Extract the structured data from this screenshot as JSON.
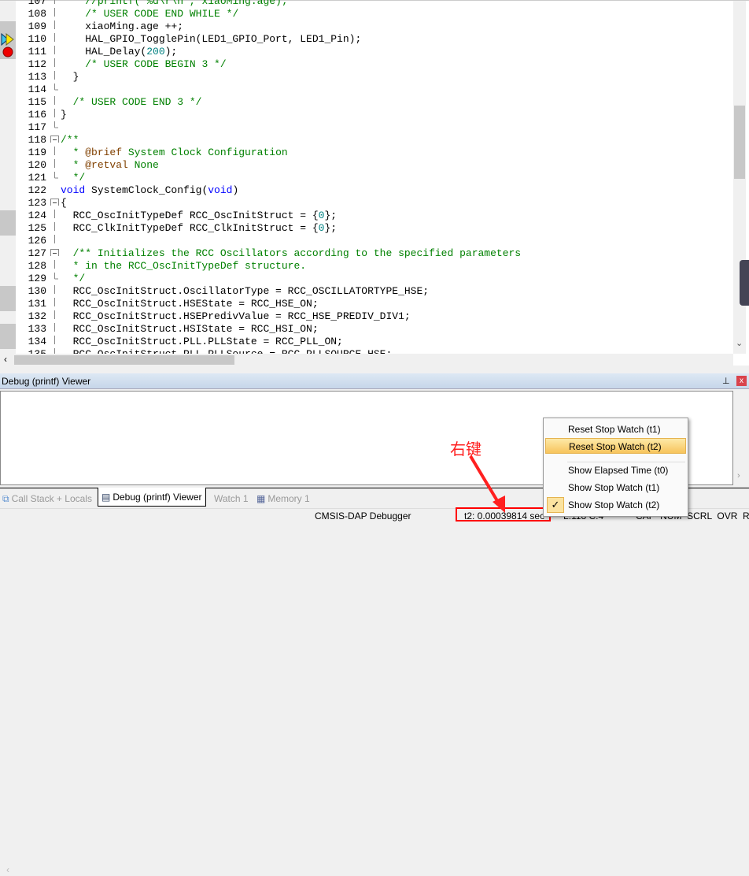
{
  "editor": {
    "lines": [
      {
        "n": "107",
        "fold": "line",
        "segs": [
          [
            "    ",
            ""
          ],
          [
            "//printf(\"%d\\r\\n\", xiaoMing.age);",
            "c"
          ]
        ]
      },
      {
        "n": "108",
        "fold": "line",
        "segs": [
          [
            "    ",
            ""
          ],
          [
            "/* USER CODE END WHILE */",
            "c"
          ]
        ]
      },
      {
        "n": "109",
        "fold": "line",
        "segs": [
          [
            "    xiaoMing.age ++;",
            ""
          ]
        ]
      },
      {
        "n": "110",
        "fold": "line",
        "segs": [
          [
            "    HAL_GPIO_TogglePin(LED1_GPIO_Port, LED1_Pin);",
            ""
          ]
        ]
      },
      {
        "n": "111",
        "fold": "line",
        "segs": [
          [
            "    HAL_Delay(",
            ""
          ],
          [
            "200",
            "n"
          ],
          [
            ");",
            ""
          ]
        ]
      },
      {
        "n": "112",
        "fold": "line",
        "segs": [
          [
            "    ",
            ""
          ],
          [
            "/* USER CODE BEGIN 3 */",
            "c"
          ]
        ]
      },
      {
        "n": "113",
        "fold": "line",
        "segs": [
          [
            "  }",
            ""
          ]
        ]
      },
      {
        "n": "114",
        "fold": "end",
        "segs": []
      },
      {
        "n": "115",
        "fold": "line",
        "segs": [
          [
            "  ",
            ""
          ],
          [
            "/* USER CODE END 3 */",
            "c"
          ]
        ]
      },
      {
        "n": "116",
        "fold": "line",
        "segs": [
          [
            "}",
            ""
          ]
        ]
      },
      {
        "n": "117",
        "fold": "end",
        "segs": []
      },
      {
        "n": "118",
        "fold": "box",
        "segs": [
          [
            "/**",
            "c"
          ]
        ]
      },
      {
        "n": "119",
        "fold": "line",
        "segs": [
          [
            "  ",
            ""
          ],
          [
            "* ",
            "c"
          ],
          [
            "@brief",
            "d"
          ],
          [
            " System Clock Configuration",
            "c"
          ]
        ]
      },
      {
        "n": "120",
        "fold": "line",
        "segs": [
          [
            "  ",
            ""
          ],
          [
            "* ",
            "c"
          ],
          [
            "@retval",
            "d"
          ],
          [
            " None",
            "c"
          ]
        ]
      },
      {
        "n": "121",
        "fold": "end",
        "segs": [
          [
            "  ",
            ""
          ],
          [
            "*/",
            "c"
          ]
        ]
      },
      {
        "n": "122",
        "fold": "",
        "segs": [
          [
            "void",
            "k"
          ],
          [
            " SystemClock_Config(",
            ""
          ],
          [
            "void",
            "k"
          ],
          [
            ")",
            ""
          ]
        ]
      },
      {
        "n": "123",
        "fold": "box",
        "segs": [
          [
            "{",
            ""
          ]
        ]
      },
      {
        "n": "124",
        "fold": "line",
        "segs": [
          [
            "  RCC_OscInitTypeDef RCC_OscInitStruct = {",
            ""
          ],
          [
            "0",
            "n"
          ],
          [
            "};",
            ""
          ]
        ]
      },
      {
        "n": "125",
        "fold": "line",
        "segs": [
          [
            "  RCC_ClkInitTypeDef RCC_ClkInitStruct = {",
            ""
          ],
          [
            "0",
            "n"
          ],
          [
            "};",
            ""
          ]
        ]
      },
      {
        "n": "126",
        "fold": "line",
        "segs": []
      },
      {
        "n": "127",
        "fold": "box",
        "segs": [
          [
            "  ",
            ""
          ],
          [
            "/** Initializes the RCC Oscillators according to the specified parameters",
            "c"
          ]
        ]
      },
      {
        "n": "128",
        "fold": "line",
        "segs": [
          [
            "  ",
            ""
          ],
          [
            "* in the RCC_OscInitTypeDef structure.",
            "c"
          ]
        ]
      },
      {
        "n": "129",
        "fold": "end",
        "segs": [
          [
            "  ",
            ""
          ],
          [
            "*/",
            "c"
          ]
        ]
      },
      {
        "n": "130",
        "fold": "line",
        "segs": [
          [
            "  RCC_OscInitStruct.OscillatorType = RCC_OSCILLATORTYPE_HSE;",
            ""
          ]
        ]
      },
      {
        "n": "131",
        "fold": "line",
        "segs": [
          [
            "  RCC_OscInitStruct.HSEState = RCC_HSE_ON;",
            ""
          ]
        ]
      },
      {
        "n": "132",
        "fold": "line",
        "segs": [
          [
            "  RCC_OscInitStruct.HSEPredivValue = RCC_HSE_PREDIV_DIV1;",
            ""
          ]
        ]
      },
      {
        "n": "133",
        "fold": "line",
        "segs": [
          [
            "  RCC_OscInitStruct.HSIState = RCC_HSI_ON;",
            ""
          ]
        ]
      },
      {
        "n": "134",
        "fold": "line",
        "segs": [
          [
            "  RCC_OscInitStruct.PLL.PLLState = RCC_PLL_ON;",
            ""
          ]
        ]
      },
      {
        "n": "135",
        "fold": "line",
        "segs": [
          [
            "  RCC_OscInitStruct.PLL.PLLSource = RCC_PLLSOURCE_HSE;",
            ""
          ]
        ]
      }
    ],
    "current_line": "110",
    "breakpoint_line": "111"
  },
  "panel": {
    "title": "Debug (printf) Viewer",
    "pin_icon": "pin-icon",
    "close_icon": "close-icon"
  },
  "tabs": [
    {
      "label": "Call Stack + Locals",
      "icon": "call-stack-icon",
      "active": false
    },
    {
      "label": "Debug (printf) Viewer",
      "icon": "debug-viewer-icon",
      "active": true
    },
    {
      "label": "Watch 1",
      "icon": "",
      "active": false
    },
    {
      "label": "Memory 1",
      "icon": "memory-icon",
      "active": false
    }
  ],
  "status": {
    "debugger": "CMSIS-DAP Debugger",
    "stopwatch": "t2: 0.00039814 sec",
    "position": "L:118 C:4",
    "flags": "CAP  NUM  SCRL  OVR  R/W"
  },
  "context_menu": {
    "items": [
      {
        "label": "Reset Stop Watch (t1)",
        "highlighted": false,
        "checked": false
      },
      {
        "label": "Reset Stop Watch (t2)",
        "highlighted": true,
        "checked": false
      },
      {
        "label": "Show Elapsed Time (t0)",
        "highlighted": false,
        "checked": false
      },
      {
        "label": "Show Stop Watch (t1)",
        "highlighted": false,
        "checked": false
      },
      {
        "label": "Show Stop Watch (t2)",
        "highlighted": false,
        "checked": true
      }
    ]
  },
  "annotation": {
    "text": "右键",
    "color": "#ff2020"
  },
  "colors": {
    "comment": "#008000",
    "keyword": "#0000ff",
    "number": "#008080",
    "highlight": "#f7c45c",
    "annotation": "#ff0000"
  }
}
